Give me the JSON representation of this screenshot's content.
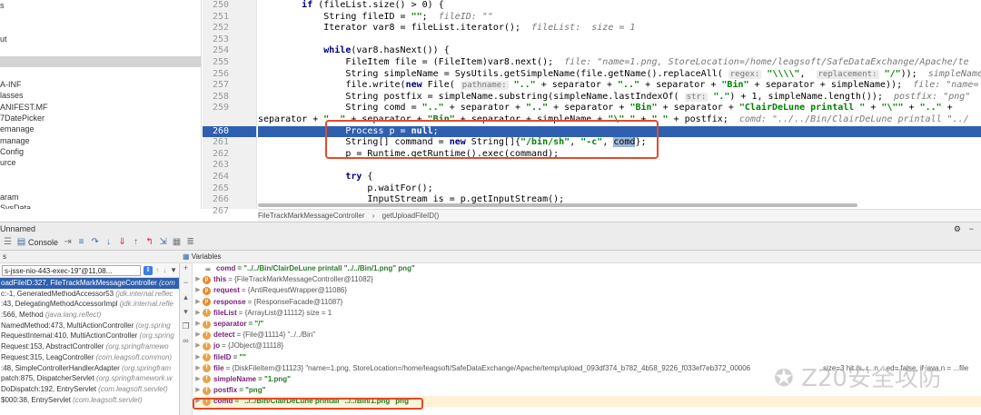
{
  "project_tree": {
    "items": [
      "s",
      "",
      "",
      "ut",
      "",
      "",
      "",
      "A-INF",
      "lasses",
      "ANIFEST.MF",
      "7DatePicker",
      "emanage",
      "manage",
      "Config",
      "urce",
      "",
      "",
      "aram",
      "SysData"
    ],
    "selected_index": 5
  },
  "editor": {
    "line_numbers": [
      "250",
      "251",
      "252",
      "253",
      "254",
      "255",
      "256",
      "257",
      "258",
      "259",
      "",
      "260",
      "261",
      "262",
      "263",
      "264",
      "265",
      "266",
      "267"
    ],
    "highlighted_line": "260",
    "lines": [
      {
        "parts": [
          {
            "t": "        "
          },
          {
            "t": "if",
            "c": "kw"
          },
          {
            "t": " (fileList.size() > 0) {"
          }
        ]
      },
      {
        "parts": [
          {
            "t": "            String fileID = "
          },
          {
            "t": "\"\"",
            "c": "str"
          },
          {
            "t": ";  "
          },
          {
            "t": "fileID: \"\"",
            "c": "cmt"
          }
        ]
      },
      {
        "parts": [
          {
            "t": "            Iterator var8 = fileList.iterator();  "
          },
          {
            "t": "fileList:  size = 1",
            "c": "cmt"
          }
        ]
      },
      {
        "parts": [
          {
            "t": ""
          }
        ]
      },
      {
        "parts": [
          {
            "t": "            "
          },
          {
            "t": "while",
            "c": "kw"
          },
          {
            "t": "(var8.hasNext()) {"
          }
        ]
      },
      {
        "parts": [
          {
            "t": "                FileItem file = (FileItem)var8.next();  "
          },
          {
            "t": "file: \"name=1.png, StoreLocation=/home/leagsoft/SafeDataExchange/Apache/te",
            "c": "cmt"
          }
        ]
      },
      {
        "parts": [
          {
            "t": "                String simpleName = SysUtils.getSimpleName(file.getName().replaceAll( "
          },
          {
            "t": "regex:",
            "c": "hint"
          },
          {
            "t": " "
          },
          {
            "t": "\"\\\\\\\\\"",
            "c": "str"
          },
          {
            "t": ",  "
          },
          {
            "t": "replacement:",
            "c": "hint"
          },
          {
            "t": " "
          },
          {
            "t": "\"/\"",
            "c": "str"
          },
          {
            "t": "));  "
          },
          {
            "t": "simpleName: ",
            "c": "cmt"
          }
        ]
      },
      {
        "parts": [
          {
            "t": "                file.write("
          },
          {
            "t": "new",
            "c": "kw"
          },
          {
            "t": " File( "
          },
          {
            "t": "pathname:",
            "c": "hint"
          },
          {
            "t": " "
          },
          {
            "t": "\"..\"",
            "c": "str"
          },
          {
            "t": " + separator + "
          },
          {
            "t": "\"..\"",
            "c": "str"
          },
          {
            "t": " + separator + "
          },
          {
            "t": "\"Bin\"",
            "c": "str"
          },
          {
            "t": " + separator + simpleName));  "
          },
          {
            "t": "file: \"name=",
            "c": "cmt"
          }
        ]
      },
      {
        "parts": [
          {
            "t": "                String postfix = simpleName.substring(simpleName.lastIndexOf( "
          },
          {
            "t": "str:",
            "c": "hint"
          },
          {
            "t": " "
          },
          {
            "t": "\".\"",
            "c": "str"
          },
          {
            "t": ") + 1, simpleName.length());  "
          },
          {
            "t": "postfix: \"png\"",
            "c": "cmt"
          }
        ]
      },
      {
        "parts": [
          {
            "t": "                String comd = "
          },
          {
            "t": "\"..\"",
            "c": "str"
          },
          {
            "t": " + separator + "
          },
          {
            "t": "\"..\"",
            "c": "str"
          },
          {
            "t": " + separator + "
          },
          {
            "t": "\"Bin\"",
            "c": "str"
          },
          {
            "t": " + separator + "
          },
          {
            "t": "\"ClairDeLune printall \"",
            "c": "str"
          },
          {
            "t": " + "
          },
          {
            "t": "\"\\\"\"",
            "c": "str"
          },
          {
            "t": " + "
          },
          {
            "t": "\"..\"",
            "c": "str"
          },
          {
            "t": " +"
          }
        ]
      },
      {
        "parts": [
          {
            "t": "separator + "
          },
          {
            "t": "\"..\"",
            "c": "str"
          },
          {
            "t": " + separator + "
          },
          {
            "t": "\"Bin\"",
            "c": "str"
          },
          {
            "t": " + separator + simpleName + "
          },
          {
            "t": "\"\\\" \"",
            "c": "str"
          },
          {
            "t": " + "
          },
          {
            "t": "\" \"",
            "c": "str"
          },
          {
            "t": " + postfix;  "
          },
          {
            "t": "comd: \"../../Bin/ClairDeLune printall \"../",
            "c": "cmt"
          }
        ]
      },
      {
        "parts": [
          {
            "t": "                Process p = "
          },
          {
            "t": "null",
            "c": "kw"
          },
          {
            "t": ";"
          }
        ]
      },
      {
        "parts": [
          {
            "t": "                String[] command = "
          },
          {
            "t": "new",
            "c": "kw"
          },
          {
            "t": " String[]{"
          },
          {
            "t": "\"/bin/sh\"",
            "c": "str"
          },
          {
            "t": ", "
          },
          {
            "t": "\"-c\"",
            "c": "str"
          },
          {
            "t": ", "
          },
          {
            "t": "comd",
            "c": "sel-word"
          },
          {
            "t": "};"
          }
        ]
      },
      {
        "parts": [
          {
            "t": "                p = Runtime.getRuntime().exec(command);"
          }
        ]
      },
      {
        "parts": [
          {
            "t": ""
          }
        ]
      },
      {
        "parts": [
          {
            "t": "                "
          },
          {
            "t": "try",
            "c": "kw"
          },
          {
            "t": " {"
          }
        ]
      },
      {
        "parts": [
          {
            "t": "                    p.waitFor();"
          }
        ]
      },
      {
        "parts": [
          {
            "t": "                    InputStream is = p.getInputStream();"
          }
        ]
      },
      {
        "parts": [
          {
            "t": ""
          }
        ]
      }
    ]
  },
  "breadcrumbs": [
    "FileTrackMarkMessageController",
    "getUploadFileID()"
  ],
  "debug": {
    "title": "Unnamed",
    "tab_console": "Console",
    "frames_header": "s",
    "variables_header": "Variables",
    "thread_selector": "s-jsse-nio-443-exec-19\"@11,08...",
    "frames": [
      {
        "text": "oadFileID:327, FileTrackMarkMessageController ",
        "cls": "(com",
        "selected": true
      },
      {
        "text": "c:-1, GeneratedMethodAccessor53 ",
        "cls": "(jdk.internal.reflec"
      },
      {
        "text": ":43, DelegatingMethodAccessorImpl ",
        "cls": "(jdk.internal.refle"
      },
      {
        "text": ":566, Method ",
        "cls": "(java.lang.reflect)"
      },
      {
        "text": "NamedMethod:473, MultiActionController ",
        "cls": "(org.spring"
      },
      {
        "text": "RequestInternal:410, MultiActionController ",
        "cls": "(org.spring"
      },
      {
        "text": "Request:153, AbstractController ",
        "cls": "(org.springframewo"
      },
      {
        "text": "Request:315, LeagController ",
        "cls": "(com.leagsoft.common)"
      },
      {
        "text": ":48, SimpleControllerHandlerAdapter ",
        "cls": "(org.springfram"
      },
      {
        "text": "patch:875, DispatcherServlet ",
        "cls": "(org.springframework.w"
      },
      {
        "text": "DoDispatch:192, EntryServlet ",
        "cls": "(com.leagsoft.servlet)"
      },
      {
        "text": "$000:38, EntryServlet ",
        "cls": "(com.leagsoft.servlet)"
      }
    ],
    "variables": [
      {
        "icon": "oo",
        "name": "comd",
        "value": "= \"../../Bin/ClairDeLune printall \"../../Bin/1.png\" png\"",
        "string": true,
        "expand": false
      },
      {
        "icon": "p",
        "name": "this",
        "value": "= {FileTrackMarkMessageController@11082}",
        "expand": true
      },
      {
        "icon": "p",
        "name": "request",
        "value": "= {AntiRequestWrapper@11086}",
        "expand": true
      },
      {
        "icon": "p",
        "name": "response",
        "value": "= {ResponseFacade@11087}",
        "expand": true
      },
      {
        "icon": "f",
        "name": "fileList",
        "value": "= {ArrayList@11112}  size = 1",
        "expand": true
      },
      {
        "icon": "f",
        "name": "separator",
        "value": "= \"/\"",
        "string": true,
        "expand": true
      },
      {
        "icon": "f",
        "name": "detect",
        "value": "= {File@11114} \"../../Bin\"",
        "expand": true
      },
      {
        "icon": "f",
        "name": "jo",
        "value": "= {JObject@11118}",
        "expand": true
      },
      {
        "icon": "f",
        "name": "fileID",
        "value": "= \"\"",
        "string": true,
        "expand": true
      },
      {
        "icon": "f",
        "name": "file",
        "value": "= {DiskFileItem@11123} \"name=1.png, StoreLocation=/home/leagsoft/SafeDataExchange/Apache/temp/upload_093df374_b782_4b58_9226_f033ef7eb372_00006",
        "expand": true
      },
      {
        "icon": "f",
        "name": "simpleName",
        "value": "= \"1.png\"",
        "string": true,
        "expand": true
      },
      {
        "icon": "f",
        "name": "postfix",
        "value": "= \"png\"",
        "string": true,
        "expand": true
      },
      {
        "icon": "f",
        "name": "comd",
        "value": "= \"../../Bin/ClairDeLune printall \"../../Bin/1.png\" png\"",
        "string": true,
        "expand": true,
        "last": true
      }
    ],
    "trailing_value": "size=3 hit (s, r...n ...ed= false, if 'ava n = ...file"
  },
  "watermark": "Z20安全攻防",
  "colors": {
    "highlight": "#2e5fb0",
    "annotation": "#e14b2d"
  }
}
